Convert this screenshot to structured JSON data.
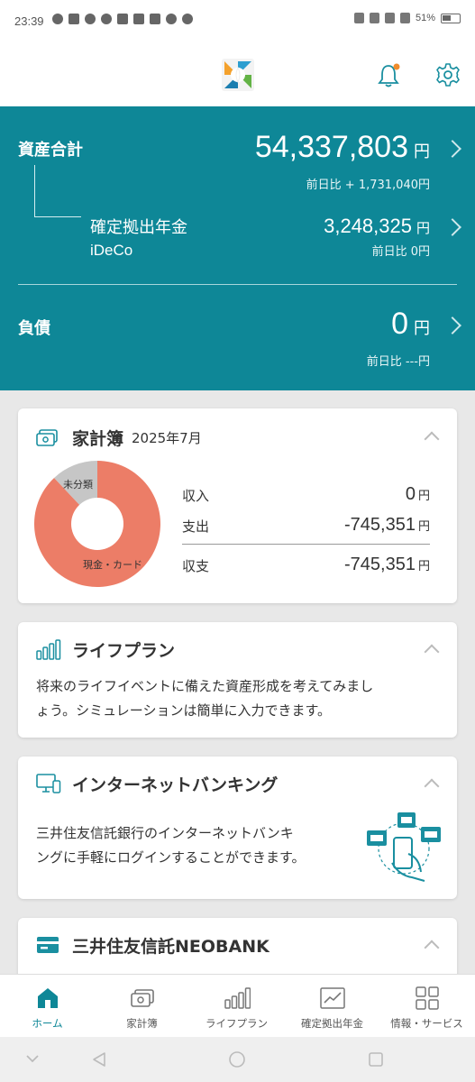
{
  "status_bar": {
    "time": "23:39",
    "battery": "51%"
  },
  "assets": {
    "total_label": "資産合計",
    "total_amount": "54,337,803",
    "total_unit": "円",
    "total_change": "前日比 + 1,731,040円",
    "pension_label": "確定拠出年金",
    "pension_sub": "iDeCo",
    "pension_amount": "3,248,325",
    "pension_unit": "円",
    "pension_change": "前日比 0円",
    "debt_label": "負債",
    "debt_amount": "0",
    "debt_unit": "円",
    "debt_change": "前日比 ---円"
  },
  "kakeibo": {
    "title": "家計簿",
    "period": "2025年7月",
    "donut": {
      "unclassified_label": "未分類",
      "cash_card_label": "現金・カード",
      "unclassified_share": 0.12,
      "colors": {
        "cash_card": "#ec7d67",
        "unclassified": "#c6c6c6"
      }
    },
    "rows": [
      {
        "label": "収入",
        "value": "0",
        "unit": "円"
      },
      {
        "label": "支出",
        "value": "-745,351",
        "unit": "円"
      },
      {
        "label": "収支",
        "value": "-745,351",
        "unit": "円"
      }
    ]
  },
  "lifeplan": {
    "title": "ライフプラン",
    "text_line1": "将来のライフイベントに備えた資産形成を考えてみまし",
    "text_line2": "ょう。シミュレーションは簡単に入力できます。"
  },
  "banking": {
    "title": "インターネットバンキング",
    "text_line1": "三井住友信託銀行のインターネットバンキ",
    "text_line2": "ングに手軽にログインすることができます。"
  },
  "neobank": {
    "title": "三井住友信託NEOBANK"
  },
  "bottom_nav": [
    {
      "label": "ホーム",
      "icon": "home-icon"
    },
    {
      "label": "家計簿",
      "icon": "wallet-icon"
    },
    {
      "label": "ライフプラン",
      "icon": "bar-chart-icon"
    },
    {
      "label": "確定拠出年金",
      "icon": "line-chart-icon"
    },
    {
      "label": "情報・サービス",
      "icon": "grid-icon"
    }
  ],
  "colors": {
    "teal": "#0e8797",
    "accent_dot": "#f08c2c",
    "icon_teal": "#1a8fa0"
  }
}
